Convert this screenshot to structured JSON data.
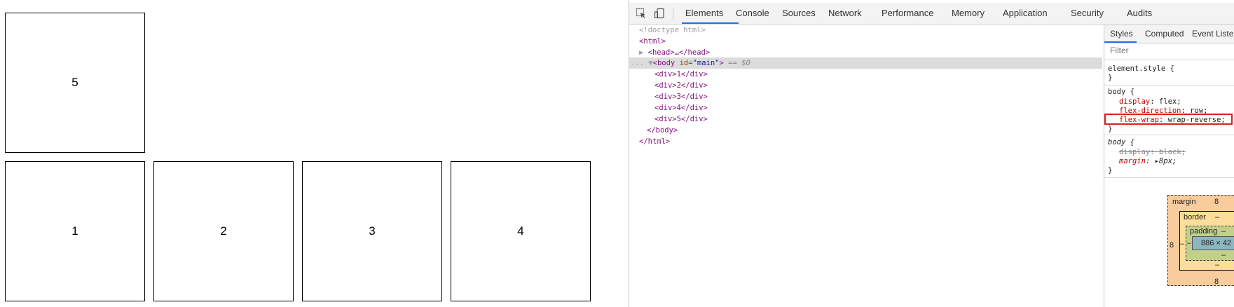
{
  "page": {
    "boxes": [
      "5",
      "1",
      "2",
      "3",
      "4"
    ]
  },
  "devtools": {
    "tabs": [
      "Elements",
      "Console",
      "Sources",
      "Network",
      "Performance",
      "Memory",
      "Application",
      "Security",
      "Audits"
    ],
    "active_tab": "Elements",
    "icons": [
      "inspect-element-icon",
      "device-toolbar-icon"
    ],
    "dom": {
      "doctype": "<!doctype html>",
      "html_open": "<html>",
      "head": "<head>…</head>",
      "body_tag": "body",
      "body_attr": "id",
      "body_attr_val": "\"main\"",
      "selected_marker": "== $0",
      "ellipsis": "...",
      "children": [
        "<div>1</div>",
        "<div>2</div>",
        "<div>3</div>",
        "<div>4</div>",
        "<div>5</div>"
      ],
      "body_close": "</body>",
      "html_close": "</html>"
    },
    "styles": {
      "tabs": [
        "Styles",
        "Computed",
        "Event Listeners"
      ],
      "filter_placeholder": "Filter",
      "element_style": "element.style {",
      "close": "}",
      "rule1_selector": "body {",
      "rule1": [
        {
          "prop": "display",
          "value": "flex;"
        },
        {
          "prop": "flex-direction",
          "value": "row;"
        },
        {
          "prop": "flex-wrap",
          "value": "wrap-reverse;"
        }
      ],
      "rule2_selector": "body {",
      "rule2": [
        {
          "prop": "display",
          "value": "block;"
        },
        {
          "prop": "margin",
          "value": "8px;"
        }
      ]
    },
    "box_model": {
      "margin_label": "margin",
      "margin_top": "8",
      "margin_left": "8",
      "margin_bottom": "8",
      "border_label": "border",
      "border_top": "–",
      "border_left": "–",
      "border_bottom": "–",
      "padding_label": "padding",
      "padding_top": "–",
      "padding_left": "–",
      "padding_bottom": "–",
      "content_size": "886 × 42"
    }
  }
}
